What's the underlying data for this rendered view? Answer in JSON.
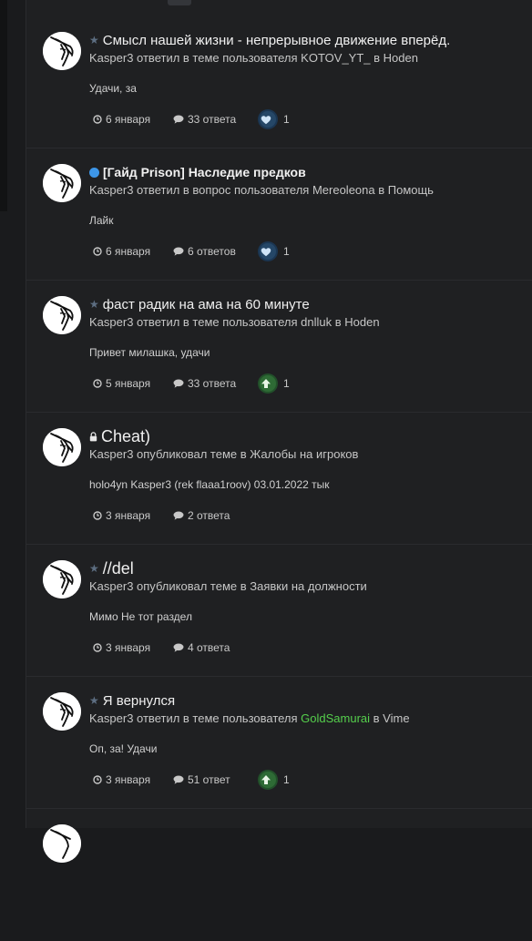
{
  "colors": {
    "background": "#1a1b1d",
    "panel": "#1f2022",
    "highlight_user": "#55cf4c",
    "heart_badge": "#254767",
    "upvote_badge": "#2e6b35"
  },
  "entries": [
    {
      "marker": "star-icon",
      "title": "Смысл нашей жизни - непрерывное движение вперёд.",
      "meta": "Kasper3 ответил в теме пользователя KOTOV_YT_ в Hoden",
      "meta_parts": null,
      "excerpt": "Удачи, за",
      "date": "6 января",
      "replies": "33 ответа",
      "reaction": "heart-icon",
      "reaction_count": "1"
    },
    {
      "marker": "unread-dot-icon",
      "title": "[Гайд Prison] Наследие предков",
      "meta": "Kasper3 ответил в вопрос пользователя Mereoleona в Помощь",
      "meta_parts": null,
      "excerpt": "Лайк",
      "date": "6 января",
      "replies": "6 ответов",
      "reaction": "heart-icon",
      "reaction_count": "1"
    },
    {
      "marker": "star-icon",
      "title": "фаст радик на ама на 60 минуте",
      "meta": "Kasper3 ответил в теме пользователя dnlluk в Hoden",
      "meta_parts": null,
      "excerpt": "Привет милашка, удачи",
      "date": "5 января",
      "replies": "33 ответа",
      "reaction": "upvote-icon",
      "reaction_count": "1"
    },
    {
      "marker": "lock-icon",
      "title": "Cheat)",
      "meta": "Kasper3 опубликовал теме в Жалобы на игроков",
      "meta_parts": null,
      "excerpt": "holo4yn Kasper3 (rek flaaa1roov) 03.01.2022 тык",
      "date": "3 января",
      "replies": "2 ответа",
      "reaction": null,
      "reaction_count": null
    },
    {
      "marker": "star-icon",
      "title": "//del",
      "meta": "Kasper3 опубликовал теме в Заявки на должности",
      "meta_parts": null,
      "excerpt": "Мимо Не тот раздел",
      "date": "3 января",
      "replies": "4 ответа",
      "reaction": null,
      "reaction_count": null
    },
    {
      "marker": "star-icon",
      "title": "Я вернулся",
      "meta": null,
      "meta_parts": {
        "before": "Kasper3 ответил в теме пользователя ",
        "user": "GoldSamurai",
        "after": " в Vime"
      },
      "excerpt": "Оп, за! Удачи",
      "date": "3 января",
      "replies": "51 ответ",
      "reaction": "upvote-icon",
      "reaction_count": "1"
    }
  ]
}
